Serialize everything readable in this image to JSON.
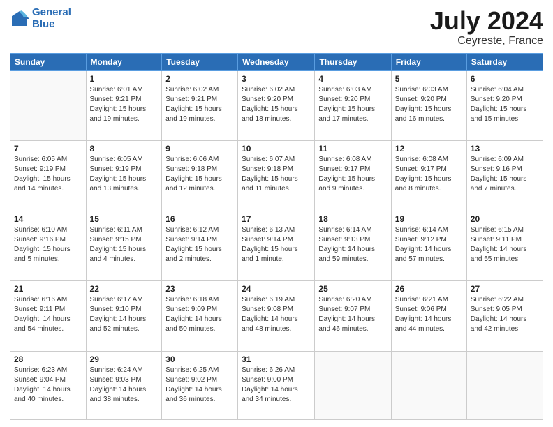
{
  "logo": {
    "line1": "General",
    "line2": "Blue"
  },
  "title": "July 2024",
  "subtitle": "Ceyreste, France",
  "days_header": [
    "Sunday",
    "Monday",
    "Tuesday",
    "Wednesday",
    "Thursday",
    "Friday",
    "Saturday"
  ],
  "weeks": [
    [
      {
        "day": "",
        "info": ""
      },
      {
        "day": "1",
        "info": "Sunrise: 6:01 AM\nSunset: 9:21 PM\nDaylight: 15 hours\nand 19 minutes."
      },
      {
        "day": "2",
        "info": "Sunrise: 6:02 AM\nSunset: 9:21 PM\nDaylight: 15 hours\nand 19 minutes."
      },
      {
        "day": "3",
        "info": "Sunrise: 6:02 AM\nSunset: 9:20 PM\nDaylight: 15 hours\nand 18 minutes."
      },
      {
        "day": "4",
        "info": "Sunrise: 6:03 AM\nSunset: 9:20 PM\nDaylight: 15 hours\nand 17 minutes."
      },
      {
        "day": "5",
        "info": "Sunrise: 6:03 AM\nSunset: 9:20 PM\nDaylight: 15 hours\nand 16 minutes."
      },
      {
        "day": "6",
        "info": "Sunrise: 6:04 AM\nSunset: 9:20 PM\nDaylight: 15 hours\nand 15 minutes."
      }
    ],
    [
      {
        "day": "7",
        "info": "Sunrise: 6:05 AM\nSunset: 9:19 PM\nDaylight: 15 hours\nand 14 minutes."
      },
      {
        "day": "8",
        "info": "Sunrise: 6:05 AM\nSunset: 9:19 PM\nDaylight: 15 hours\nand 13 minutes."
      },
      {
        "day": "9",
        "info": "Sunrise: 6:06 AM\nSunset: 9:18 PM\nDaylight: 15 hours\nand 12 minutes."
      },
      {
        "day": "10",
        "info": "Sunrise: 6:07 AM\nSunset: 9:18 PM\nDaylight: 15 hours\nand 11 minutes."
      },
      {
        "day": "11",
        "info": "Sunrise: 6:08 AM\nSunset: 9:17 PM\nDaylight: 15 hours\nand 9 minutes."
      },
      {
        "day": "12",
        "info": "Sunrise: 6:08 AM\nSunset: 9:17 PM\nDaylight: 15 hours\nand 8 minutes."
      },
      {
        "day": "13",
        "info": "Sunrise: 6:09 AM\nSunset: 9:16 PM\nDaylight: 15 hours\nand 7 minutes."
      }
    ],
    [
      {
        "day": "14",
        "info": "Sunrise: 6:10 AM\nSunset: 9:16 PM\nDaylight: 15 hours\nand 5 minutes."
      },
      {
        "day": "15",
        "info": "Sunrise: 6:11 AM\nSunset: 9:15 PM\nDaylight: 15 hours\nand 4 minutes."
      },
      {
        "day": "16",
        "info": "Sunrise: 6:12 AM\nSunset: 9:14 PM\nDaylight: 15 hours\nand 2 minutes."
      },
      {
        "day": "17",
        "info": "Sunrise: 6:13 AM\nSunset: 9:14 PM\nDaylight: 15 hours\nand 1 minute."
      },
      {
        "day": "18",
        "info": "Sunrise: 6:14 AM\nSunset: 9:13 PM\nDaylight: 14 hours\nand 59 minutes."
      },
      {
        "day": "19",
        "info": "Sunrise: 6:14 AM\nSunset: 9:12 PM\nDaylight: 14 hours\nand 57 minutes."
      },
      {
        "day": "20",
        "info": "Sunrise: 6:15 AM\nSunset: 9:11 PM\nDaylight: 14 hours\nand 55 minutes."
      }
    ],
    [
      {
        "day": "21",
        "info": "Sunrise: 6:16 AM\nSunset: 9:11 PM\nDaylight: 14 hours\nand 54 minutes."
      },
      {
        "day": "22",
        "info": "Sunrise: 6:17 AM\nSunset: 9:10 PM\nDaylight: 14 hours\nand 52 minutes."
      },
      {
        "day": "23",
        "info": "Sunrise: 6:18 AM\nSunset: 9:09 PM\nDaylight: 14 hours\nand 50 minutes."
      },
      {
        "day": "24",
        "info": "Sunrise: 6:19 AM\nSunset: 9:08 PM\nDaylight: 14 hours\nand 48 minutes."
      },
      {
        "day": "25",
        "info": "Sunrise: 6:20 AM\nSunset: 9:07 PM\nDaylight: 14 hours\nand 46 minutes."
      },
      {
        "day": "26",
        "info": "Sunrise: 6:21 AM\nSunset: 9:06 PM\nDaylight: 14 hours\nand 44 minutes."
      },
      {
        "day": "27",
        "info": "Sunrise: 6:22 AM\nSunset: 9:05 PM\nDaylight: 14 hours\nand 42 minutes."
      }
    ],
    [
      {
        "day": "28",
        "info": "Sunrise: 6:23 AM\nSunset: 9:04 PM\nDaylight: 14 hours\nand 40 minutes."
      },
      {
        "day": "29",
        "info": "Sunrise: 6:24 AM\nSunset: 9:03 PM\nDaylight: 14 hours\nand 38 minutes."
      },
      {
        "day": "30",
        "info": "Sunrise: 6:25 AM\nSunset: 9:02 PM\nDaylight: 14 hours\nand 36 minutes."
      },
      {
        "day": "31",
        "info": "Sunrise: 6:26 AM\nSunset: 9:00 PM\nDaylight: 14 hours\nand 34 minutes."
      },
      {
        "day": "",
        "info": ""
      },
      {
        "day": "",
        "info": ""
      },
      {
        "day": "",
        "info": ""
      }
    ]
  ]
}
